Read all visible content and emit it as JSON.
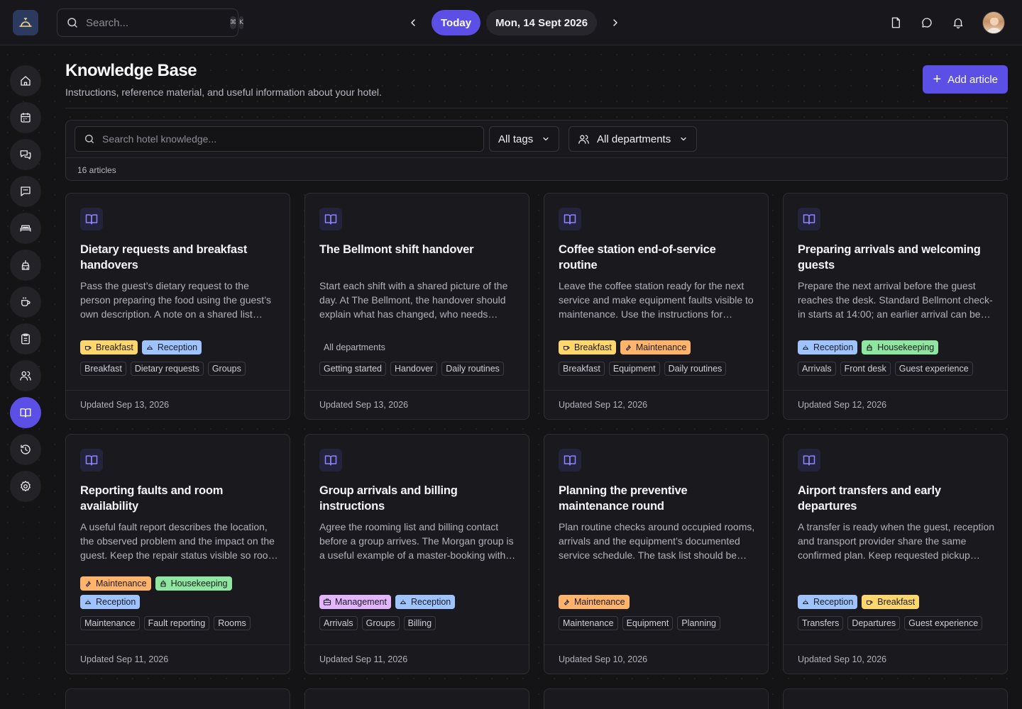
{
  "topbar": {
    "search_placeholder": "Search...",
    "shortcut_keys": [
      "⌘",
      "K"
    ],
    "today_label": "Today",
    "date_label": "Mon, 14 Sept 2026"
  },
  "colors": {
    "accent": "#5b4fe6",
    "breakfast": "#ffd66b",
    "reception": "#9ec3ff",
    "maintenance": "#ffb36b",
    "housekeeping": "#8ee6a0",
    "management": "#e3b5ff"
  },
  "page": {
    "title": "Knowledge Base",
    "subtitle": "Instructions, reference material, and useful information about your hotel.",
    "add_label": "Add article"
  },
  "filters": {
    "search_placeholder": "Search hotel knowledge...",
    "tags_label": "All tags",
    "departments_label": "All departments",
    "count_label": "16 articles"
  },
  "articles": [
    {
      "title": "Dietary requests and breakfast handovers",
      "desc": "Pass the guest’s dietary request to the person preparing the food using the guest’s own description. A note on a shared list helps the team pick up the request quickly.",
      "departments": [
        {
          "label": "Breakfast",
          "kind": "breakfast"
        },
        {
          "label": "Reception",
          "kind": "reception"
        }
      ],
      "tags": [
        "Breakfast",
        "Dietary requests",
        "Groups"
      ],
      "updated": "Updated Sep 13, 2026"
    },
    {
      "title": "The Bellmont shift handover",
      "desc": "Start each shift with a shared picture of the day. At The Bellmont, the handover should explain what has changed, who needs follow-up and what the next team should watch for.",
      "departments_text": "All departments",
      "tags": [
        "Getting started",
        "Handover",
        "Daily routines"
      ],
      "updated": "Updated Sep 13, 2026"
    },
    {
      "title": "Coffee station end-of-service routine",
      "desc": "Leave the coffee station ready for the next service and make equipment faults visible to maintenance. Use the instructions for cleaning, restocking and reporting.",
      "departments": [
        {
          "label": "Breakfast",
          "kind": "breakfast"
        },
        {
          "label": "Maintenance",
          "kind": "maintenance"
        }
      ],
      "tags": [
        "Breakfast",
        "Equipment",
        "Daily routines"
      ],
      "updated": "Updated Sep 12, 2026"
    },
    {
      "title": "Preparing arrivals and welcoming guests",
      "desc": "Prepare the next arrival before the guest reaches the desk. Standard Bellmont check-in starts at 14:00; an earlier arrival can be arranged when the room is ready.",
      "departments": [
        {
          "label": "Reception",
          "kind": "reception"
        },
        {
          "label": "Housekeeping",
          "kind": "housekeeping"
        }
      ],
      "tags": [
        "Arrivals",
        "Front desk",
        "Guest experience"
      ],
      "updated": "Updated Sep 12, 2026"
    },
    {
      "title": "Reporting faults and room availability",
      "desc": "A useful fault report describes the location, the observed problem and the impact on the guest. Keep the repair status visible so room availability stays accurate.",
      "departments": [
        {
          "label": "Maintenance",
          "kind": "maintenance"
        },
        {
          "label": "Housekeeping",
          "kind": "housekeeping"
        },
        {
          "label": "Reception",
          "kind": "reception"
        }
      ],
      "tags": [
        "Maintenance",
        "Fault reporting",
        "Rooms"
      ],
      "updated": "Updated Sep 11, 2026"
    },
    {
      "title": "Group arrivals and billing instructions",
      "desc": "Agree the rooming list and billing contact before a group arrives. The Morgan group is a useful example of a master-booking with individual extras.",
      "departments": [
        {
          "label": "Management",
          "kind": "management"
        },
        {
          "label": "Reception",
          "kind": "reception"
        }
      ],
      "tags": [
        "Arrivals",
        "Groups",
        "Billing"
      ],
      "updated": "Updated Sep 11, 2026"
    },
    {
      "title": "Planning the preventive maintenance round",
      "desc": "Plan routine checks around occupied rooms, arrivals and the equipment’s documented service schedule. The task list should be shared with housekeeping.",
      "departments": [
        {
          "label": "Maintenance",
          "kind": "maintenance"
        }
      ],
      "tags": [
        "Maintenance",
        "Equipment",
        "Planning"
      ],
      "updated": "Updated Sep 10, 2026"
    },
    {
      "title": "Airport transfers and early departures",
      "desc": "A transfer is ready when the guest, reception and transport provider share the same confirmed plan. Keep requested pickup times and flight numbers on the booking.",
      "departments": [
        {
          "label": "Reception",
          "kind": "reception"
        },
        {
          "label": "Breakfast",
          "kind": "breakfast"
        }
      ],
      "tags": [
        "Transfers",
        "Departures",
        "Guest experience"
      ],
      "updated": "Updated Sep 10, 2026"
    }
  ]
}
